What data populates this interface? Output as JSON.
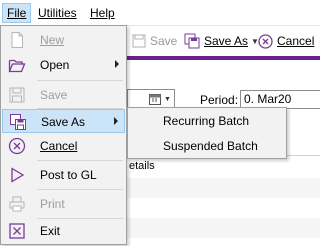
{
  "menubar": {
    "file": "File",
    "utilities": "Utilities",
    "help": "Help"
  },
  "toolbar": {
    "save": "Save",
    "save_as": "Save As",
    "cancel": "Cancel"
  },
  "form": {
    "period_label": "Period:",
    "period_value": "0. Mar20",
    "grid_header": "etails"
  },
  "file_menu": {
    "items": [
      {
        "label": "New",
        "icon": "new-doc-icon",
        "enabled": false
      },
      {
        "label": "Open",
        "icon": "open-folder-icon",
        "enabled": true,
        "submenu": true
      },
      {
        "label": "Save",
        "icon": "save-icon",
        "enabled": false
      },
      {
        "label": "Save As",
        "icon": "save-as-icon",
        "enabled": true,
        "submenu": true,
        "selected": true
      },
      {
        "label": "Cancel",
        "icon": "cancel-icon",
        "enabled": true
      },
      {
        "label": "Post to GL",
        "icon": "play-icon",
        "enabled": true
      },
      {
        "label": "Print",
        "icon": "printer-icon",
        "enabled": false
      },
      {
        "label": "Exit",
        "icon": "exit-icon",
        "enabled": true
      }
    ]
  },
  "save_as_submenu": {
    "items": [
      "Recurring Batch",
      "Suspended Batch"
    ]
  },
  "colors": {
    "accent": "#6b1f8e",
    "highlight": "#cce4f7",
    "icon_purple": "#7a3a9a"
  }
}
